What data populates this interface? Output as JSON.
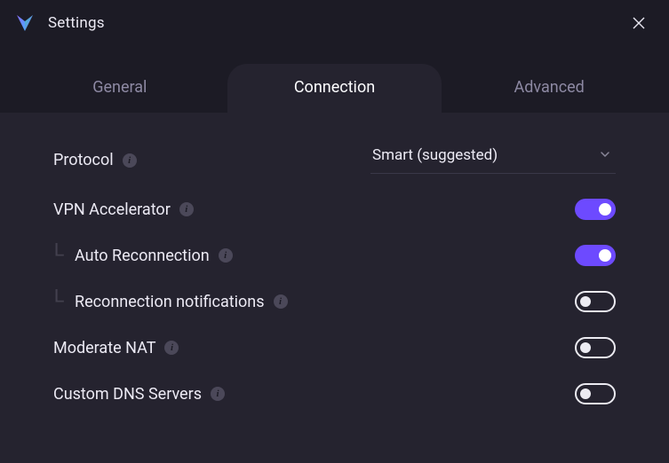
{
  "window": {
    "title": "Settings"
  },
  "tabs": {
    "general": "General",
    "connection": "Connection",
    "advanced": "Advanced"
  },
  "settings": {
    "protocol": {
      "label": "Protocol",
      "value": "Smart (suggested)"
    },
    "vpn_accel": {
      "label": "VPN Accelerator"
    },
    "auto_reconnect": {
      "label": "Auto Reconnection"
    },
    "reconnect_notif": {
      "label": "Reconnection notifications"
    },
    "moderate_nat": {
      "label": "Moderate NAT"
    },
    "custom_dns": {
      "label": "Custom DNS Servers"
    }
  }
}
